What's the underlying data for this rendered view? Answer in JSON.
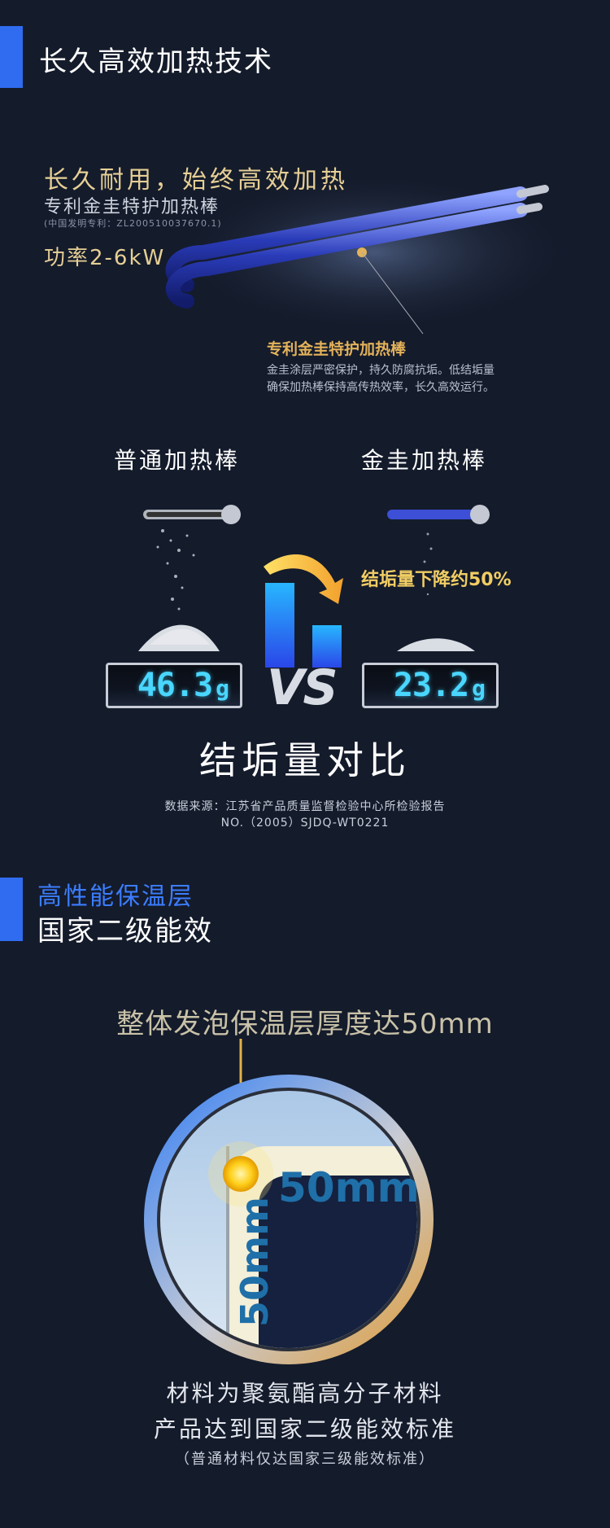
{
  "heating_section": {
    "title": "长久高效加热技术",
    "headline": "长久耐用，始终高效加热",
    "subhead": "专利金圭特护加热棒",
    "patent": "(中国发明专利：ZL200510037670.1)",
    "power": "功率2-6kW",
    "rod_caption_title": "专利金圭特护加热棒",
    "rod_caption_line1": "金圭涂层严密保护，持久防腐抗垢。低结垢量",
    "rod_caption_line2": "确保加热棒保持高传热效率，长久高效运行。"
  },
  "comparison": {
    "left_title": "普通加热棒",
    "right_title": "金圭加热棒",
    "reduction_text": "结垢量下降约50%",
    "left_value": "46.3",
    "left_unit": "g",
    "right_value": "23.2",
    "right_unit": "g",
    "vs_text": "VS",
    "title": "结垢量对比",
    "source_line1": "数据来源：江苏省产品质量监督检验中心所检验报告",
    "source_line2": "NO.（2005）SJDQ-WT0221"
  },
  "insulation_section": {
    "title_line1": "高性能保温层",
    "title_line2": "国家二级能效",
    "foam_title": "整体发泡保温层厚度达50mm",
    "thickness_h": "50mm",
    "thickness_v": "50mm",
    "footer_line1": "材料为聚氨酯高分子材料",
    "footer_line2": "产品达到国家二级能效标准",
    "footer_line3": "（普通材料仅达国家三级能效标准）"
  },
  "colors": {
    "background": "#141b2b",
    "accent_blue": "#2f6cf0",
    "gold": "#e6cf95",
    "digit_cyan": "#49d6ff"
  }
}
